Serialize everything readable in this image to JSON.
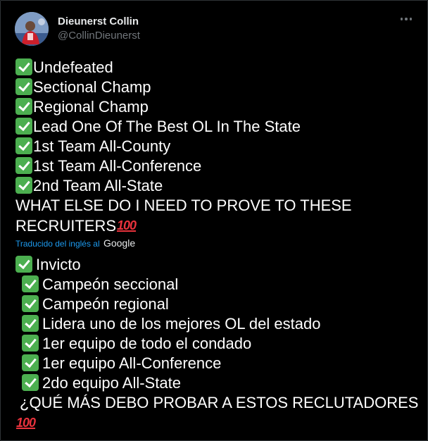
{
  "author": {
    "display_name": "Dieunerst Collin",
    "handle": "@CollinDieunerst"
  },
  "original_lines": [
    "Undefeated",
    "Sectional Champ",
    "Regional Champ",
    "Lead One Of The Best OL In The State",
    "1st Team All-County",
    "1st Team All-Conference",
    "2nd Team All-State"
  ],
  "original_closing": [
    "WHAT ELSE DO I NEED TO PROVE TO THESE",
    "RECRUITERS"
  ],
  "translation_credit": {
    "label": "Traducido del inglés al",
    "provider": "Google"
  },
  "translated_lines": [
    "Invicto",
    "Campeón seccional",
    "Campeón regional",
    "Lidera uno de los mejores OL del estado",
    "1er equipo de todo el condado",
    "1er equipo All-Conference",
    "2do equipo All-State"
  ],
  "translated_closing": "¿QUÉ MÁS DEBO PROBAR A ESTOS RECLUTADORES",
  "emoji": {
    "check": "check-mark-button",
    "hundred": "100"
  },
  "colors": {
    "background": "#000000",
    "text": "#ffffff",
    "secondary": "#71767b",
    "link": "#1d9bf0",
    "check": "#4caf50",
    "hundred": "#e8323c"
  }
}
